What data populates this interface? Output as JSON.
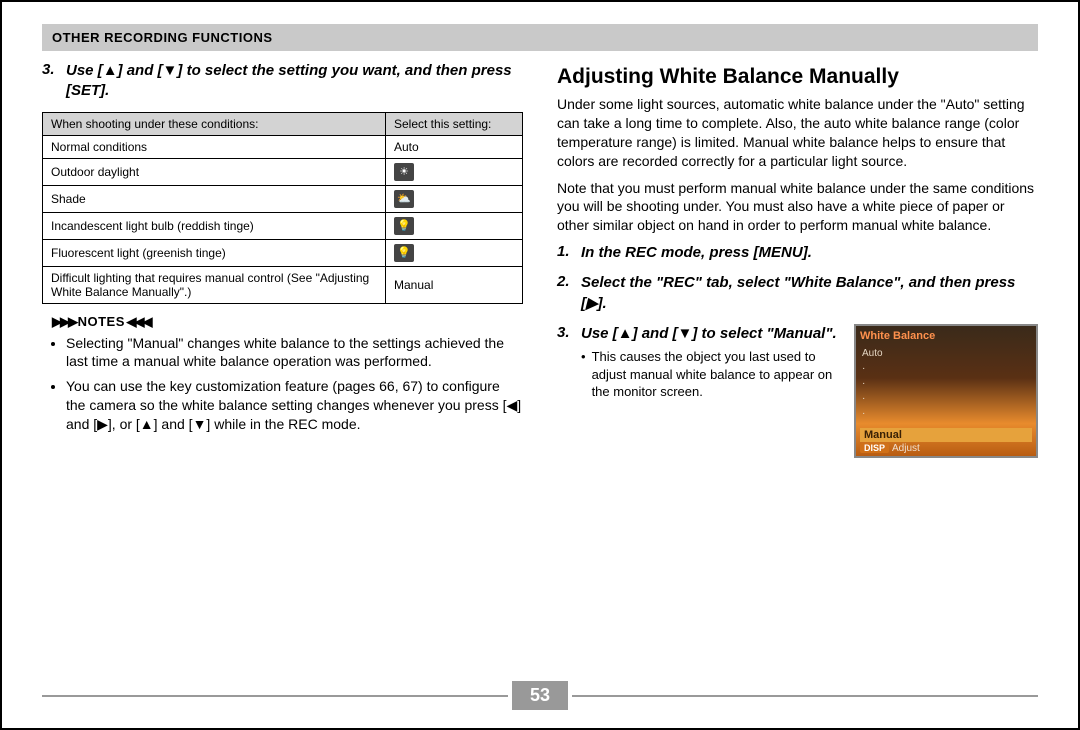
{
  "header": "OTHER RECORDING FUNCTIONS",
  "left": {
    "step3": {
      "num": "3.",
      "text_prefix": "Use [",
      "up_icon": "▲",
      "mid1": "] and [",
      "down_icon": "▼",
      "text_suffix": "] to select the setting you want, and then press [SET]."
    },
    "table": {
      "head_cond": "When shooting under these conditions:",
      "head_setting": "Select this setting:",
      "rows": [
        {
          "cond": "Normal conditions",
          "setting_text": "Auto",
          "icon": ""
        },
        {
          "cond": "Outdoor daylight",
          "setting_text": "",
          "icon": "☀"
        },
        {
          "cond": "Shade",
          "setting_text": "",
          "icon": "⛅"
        },
        {
          "cond": "Incandescent light bulb (reddish tinge)",
          "setting_text": "",
          "icon": "💡"
        },
        {
          "cond": "Fluorescent light (greenish tinge)",
          "setting_text": "",
          "icon": "💡"
        },
        {
          "cond": "Difficult lighting that requires manual control (See \"Adjusting White Balance Manually\".)",
          "setting_text": "Manual",
          "icon": ""
        }
      ]
    },
    "notes_label": "NOTES",
    "notes": [
      "Selecting \"Manual\" changes white balance to the settings achieved the last time a manual white balance operation was performed.",
      "You can use the key customization feature (pages 66, 67) to configure the camera so the white balance setting changes whenever you press [◀] and [▶], or [▲] and [▼] while in the REC mode."
    ]
  },
  "right": {
    "title": "Adjusting White Balance Manually",
    "para1": "Under some light sources, automatic white balance under the \"Auto\" setting can take a long time to complete. Also, the auto white balance range (color temperature range) is limited. Manual white balance helps to ensure that colors are recorded correctly for a particular light source.",
    "para2": "Note that you must perform manual white balance under the same conditions you will be shooting under. You must also have a white piece of paper or other similar object on hand in order to perform manual white balance.",
    "steps": {
      "s1": {
        "num": "1.",
        "text": "In the REC mode, press [MENU]."
      },
      "s2": {
        "num": "2.",
        "text": "Select the \"REC\" tab, select \"White Balance\", and then press [▶]."
      },
      "s3": {
        "num": "3.",
        "text": "Use [▲] and [▼] to select \"Manual\"."
      }
    },
    "s3_sub": "This causes the object you last used to adjust manual white balance to appear on the monitor screen.",
    "thumb": {
      "title": "White Balance",
      "items": [
        "Auto",
        "",
        "",
        "",
        ""
      ],
      "selected": "Manual",
      "bottom_label": "DISP",
      "bottom_text": "Adjust"
    }
  },
  "page_number": "53"
}
